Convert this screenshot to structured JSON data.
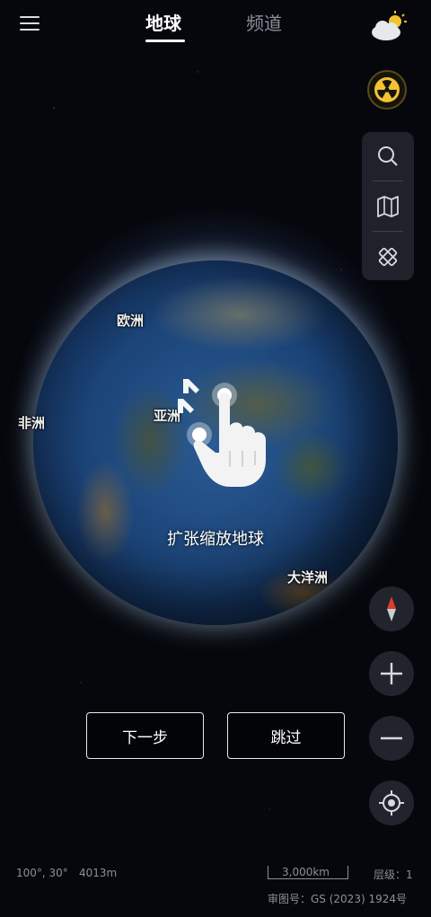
{
  "topbar": {
    "tabs": [
      {
        "label": "地球",
        "active": true
      },
      {
        "label": "频道",
        "active": false
      }
    ]
  },
  "globe": {
    "continent_labels": {
      "europe": "欧洲",
      "asia": "亚洲",
      "africa": "非洲",
      "oceania": "大洋洲"
    },
    "gesture_hint": "扩张缩放地球"
  },
  "guide": {
    "next_label": "下一步",
    "skip_label": "跳过"
  },
  "status": {
    "coordinates": "100°, 30°",
    "altitude": "4013m",
    "scale": "3,000km",
    "level": "层级：1",
    "approval": "审图号：GS (2023) 1924号"
  },
  "colors": {
    "accent_yellow": "#f2c230",
    "compass_red": "#e03b2e",
    "background": "#05070c"
  },
  "icons": [
    "menu-icon",
    "weather-icon",
    "radiation-icon",
    "search-icon",
    "map-icon",
    "ruler-icon",
    "compass-icon",
    "zoom-in-icon",
    "zoom-out-icon",
    "locate-icon"
  ]
}
